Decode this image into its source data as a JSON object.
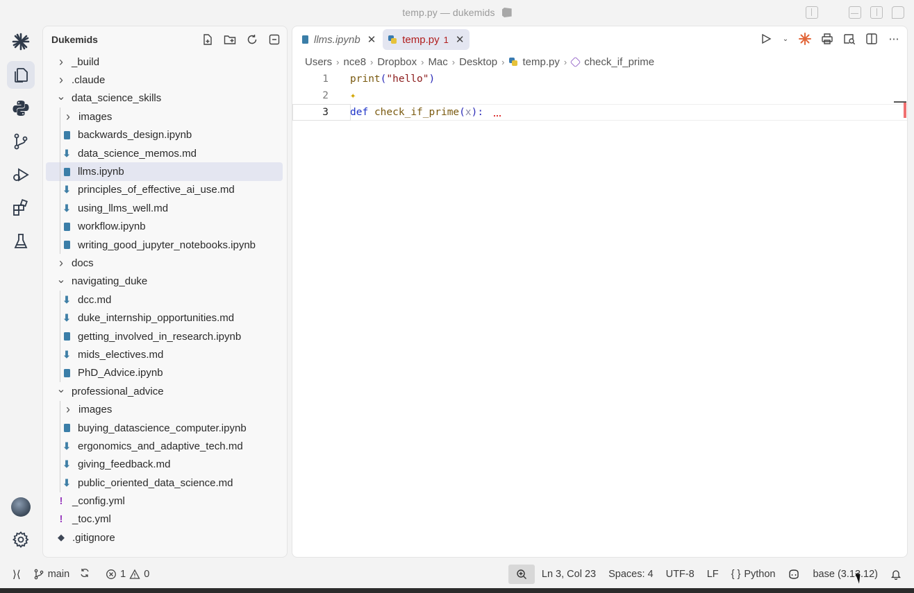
{
  "window": {
    "title": "temp.py — dukemids"
  },
  "activity_bar": {
    "items": [
      "claude-icon",
      "explorer-icon",
      "python-icon",
      "source-control-icon",
      "run-debug-icon",
      "extensions-icon",
      "testing-icon"
    ],
    "bottom": [
      "account-avatar",
      "settings-gear-icon"
    ]
  },
  "sidebar": {
    "title": "Dukemids",
    "items": [
      {
        "label": "_build",
        "type": "folder",
        "state": "collapsed",
        "depth": 0
      },
      {
        "label": ".claude",
        "type": "folder",
        "state": "collapsed",
        "depth": 0
      },
      {
        "label": "data_science_skills",
        "type": "folder",
        "state": "expanded",
        "depth": 0
      },
      {
        "label": "images",
        "type": "folder",
        "state": "collapsed",
        "depth": 1
      },
      {
        "label": "backwards_design.ipynb",
        "type": "notebook",
        "depth": 1
      },
      {
        "label": "data_science_memos.md",
        "type": "markdown",
        "depth": 1
      },
      {
        "label": "llms.ipynb",
        "type": "notebook",
        "depth": 1,
        "selected": true
      },
      {
        "label": "principles_of_effective_ai_use.md",
        "type": "markdown",
        "depth": 1
      },
      {
        "label": "using_llms_well.md",
        "type": "markdown",
        "depth": 1
      },
      {
        "label": "workflow.ipynb",
        "type": "notebook",
        "depth": 1
      },
      {
        "label": "writing_good_jupyter_notebooks.ipynb",
        "type": "notebook",
        "depth": 1
      },
      {
        "label": "docs",
        "type": "folder",
        "state": "collapsed",
        "depth": 0
      },
      {
        "label": "navigating_duke",
        "type": "folder",
        "state": "expanded",
        "depth": 0
      },
      {
        "label": "dcc.md",
        "type": "markdown",
        "depth": 1
      },
      {
        "label": "duke_internship_opportunities.md",
        "type": "markdown",
        "depth": 1
      },
      {
        "label": "getting_involved_in_research.ipynb",
        "type": "notebook",
        "depth": 1
      },
      {
        "label": "mids_electives.md",
        "type": "markdown",
        "depth": 1
      },
      {
        "label": "PhD_Advice.ipynb",
        "type": "notebook",
        "depth": 1
      },
      {
        "label": "professional_advice",
        "type": "folder",
        "state": "expanded",
        "depth": 0
      },
      {
        "label": "images",
        "type": "folder",
        "state": "collapsed",
        "depth": 1
      },
      {
        "label": "buying_datascience_computer.ipynb",
        "type": "notebook",
        "depth": 1
      },
      {
        "label": "ergonomics_and_adaptive_tech.md",
        "type": "markdown",
        "depth": 1
      },
      {
        "label": "giving_feedback.md",
        "type": "markdown",
        "depth": 1
      },
      {
        "label": "public_oriented_data_science.md",
        "type": "markdown",
        "depth": 1
      },
      {
        "label": "_config.yml",
        "type": "yaml",
        "depth": 0
      },
      {
        "label": "_toc.yml",
        "type": "yaml",
        "depth": 0
      },
      {
        "label": ".gitignore",
        "type": "git",
        "depth": 0
      }
    ]
  },
  "tabs": [
    {
      "label": "llms.ipynb",
      "active": false,
      "icon": "notebook-icon"
    },
    {
      "label": "temp.py",
      "active": true,
      "icon": "python-file-icon",
      "badge": "1"
    }
  ],
  "breadcrumb": [
    "Users",
    "nce8",
    "Dropbox",
    "Mac",
    "Desktop",
    "temp.py",
    "check_if_prime"
  ],
  "code": {
    "line_numbers": [
      "1",
      "2",
      "3"
    ],
    "line1": {
      "fn": "print",
      "open": "(",
      "str": "\"hello\"",
      "close": ")"
    },
    "line3": {
      "kw": "def",
      "name": "check_if_prime",
      "open": "(",
      "param": "x",
      "close": "):"
    }
  },
  "status": {
    "branch": "main",
    "errors": "1",
    "warnings": "0",
    "cursor": "Ln 3, Col 23",
    "spaces": "Spaces: 4",
    "encoding": "UTF-8",
    "eol": "LF",
    "language": "Python",
    "env": "base (3.13.12)"
  },
  "colors": {
    "accent_selection": "#e4e6f1",
    "error_text": "#b01c1c",
    "claude_orange": "#e2673a"
  }
}
